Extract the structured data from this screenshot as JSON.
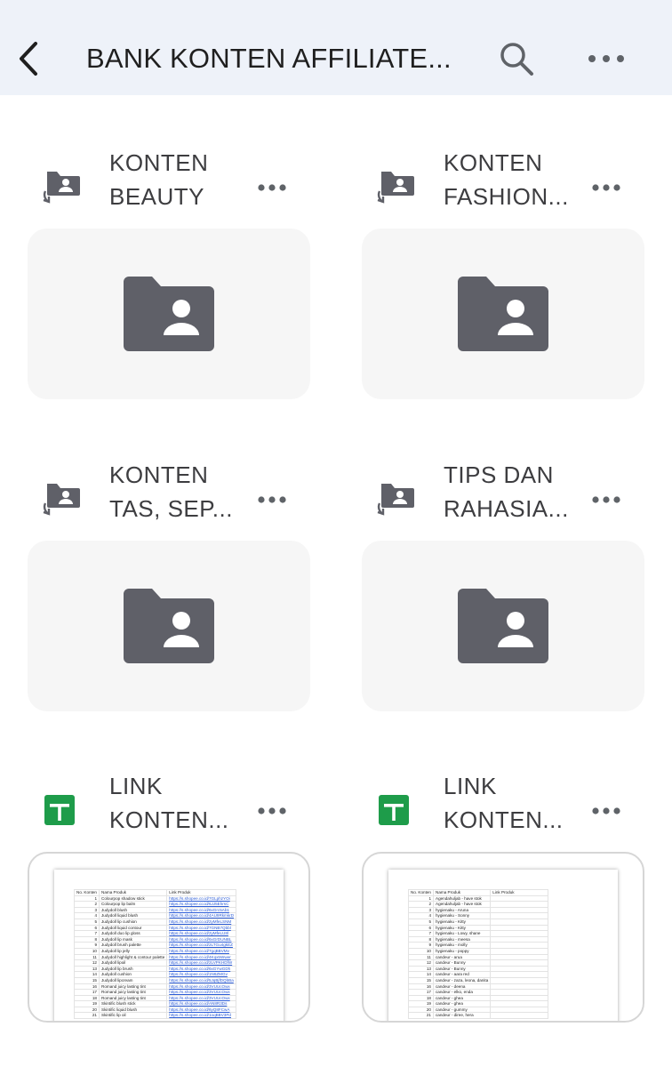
{
  "header": {
    "title": "BANK KONTEN AFFILIATE..."
  },
  "icons": {
    "back": "chevron-left-icon",
    "search": "search-icon",
    "more": "more-horizontal-icon",
    "shared_folder": "shared-folder-icon",
    "sheets": "google-sheets-icon"
  },
  "colors": {
    "header_bg": "#eef2f9",
    "folder_icon": "#5f6068",
    "sheets_green": "#1e9c4a",
    "link_blue": "#2a5bd7"
  },
  "items": [
    {
      "line1": "KONTEN",
      "line2": "BEAUTY",
      "type": "shared-folder"
    },
    {
      "line1": "KONTEN",
      "line2": "FASHION...",
      "type": "shared-folder"
    },
    {
      "line1": "KONTEN",
      "line2": "TAS, SEP...",
      "type": "shared-folder"
    },
    {
      "line1": "TIPS DAN",
      "line2": "RAHASIA...",
      "type": "shared-folder"
    },
    {
      "line1": "LINK",
      "line2": "KONTEN...",
      "type": "spreadsheet"
    },
    {
      "line1": "LINK",
      "line2": "KONTEN...",
      "type": "spreadsheet"
    }
  ],
  "sheet1": {
    "headers": [
      "No. Konten",
      "Nama Produk",
      "Link Produk"
    ],
    "rows": [
      [
        "1",
        "Colourpop shadow stick",
        "https://s.shopee.co.id/7GLphzYOi"
      ],
      [
        "2",
        "Colourpop lip balm",
        "https://s.shopee.co.id/6JJ5EhrsC"
      ],
      [
        "3",
        "Judydoll blush",
        "https://s.shopee.co.id/6xGrc5Ab1"
      ],
      [
        "4",
        "Judydoll liquid blush",
        "https://s.shopee.co.id/4AU9RkmkrD"
      ],
      [
        "5",
        "Judydoll lip cushion",
        "https://s.shopee.co.id/2yMfeLSNM"
      ],
      [
        "6",
        "Judydoll liquid contour",
        "https://s.shopee.co.id/7GNB7Qbbl"
      ],
      [
        "7",
        "Judydoll duo lip gloss",
        "https://s.shopee.co.id/2yMfeLU8l"
      ],
      [
        "8",
        "Judydoll lip mask",
        "https://s.shopee.co.id/6xGrDUNBL"
      ],
      [
        "9",
        "Judydoll brush palette",
        "https://s.shopee.co.id/2LTGu4gkEZ"
      ],
      [
        "10",
        "Judydoll lip jelly",
        "https://s.shopee.co.id/7gqBBVMv"
      ],
      [
        "11",
        "Judydoll highlight & contour palette",
        "https://s.shopee.co.id/4Kqx5Wwer"
      ],
      [
        "12",
        "Judydoll lipoil",
        "https://s.shopee.co.id/2LVPKHDfW"
      ],
      [
        "13",
        "Judydoll lip brush",
        "https://s.shopee.co.id/6xGYwGDh"
      ],
      [
        "14",
        "Judydoll cushion",
        "https://s.shopee.co.id/1N6ZMGv"
      ],
      [
        "15",
        "Judydoll lipcream",
        "https://s.shopee.co.id/5JqBjfDQbBa"
      ],
      [
        "16",
        "Romand juicy lasting tint",
        "https://s.shopee.co.id/3VUUcOwx"
      ],
      [
        "17",
        "Romand juicy lasting tint",
        "https://s.shopee.co.id/3VUUcOwx"
      ],
      [
        "18",
        "Romand juicy lasting tint",
        "https://s.shopee.co.id/3VUUcOwx"
      ],
      [
        "19",
        "Skintific blush stick",
        "https://s.shopee.co.id/AN8R3Ds"
      ],
      [
        "20",
        "Skintific liquid blush",
        "https://s.shopee.co.id/6yQ8FCwA"
      ],
      [
        "21",
        "Skintific lip oil",
        "https://s.shopee.co.id/1oqBBV3Pd"
      ]
    ]
  },
  "sheet2": {
    "headers": [
      "No. Konten",
      "Nama Produk",
      "Link Produk"
    ],
    "rows": [
      [
        "1",
        "Agendahuljab - have stok",
        ""
      ],
      [
        "2",
        "Agendahuljab - have stok",
        ""
      ],
      [
        "3",
        "hygienaku - Aruna",
        ""
      ],
      [
        "4",
        "hygienaku - Sonny",
        ""
      ],
      [
        "5",
        "hygienaku - Kitty",
        ""
      ],
      [
        "6",
        "hygienaku - Kitty",
        ""
      ],
      [
        "7",
        "hygienaku - Lowy, shane",
        ""
      ],
      [
        "8",
        "hygienaku - meesa",
        ""
      ],
      [
        "9",
        "hygienaku - molly",
        ""
      ],
      [
        "10",
        "hygienaku - poppy",
        ""
      ],
      [
        "11",
        "candeur - arua",
        ""
      ],
      [
        "12",
        "candeur - Bunny",
        ""
      ],
      [
        "13",
        "candeur - Bunny",
        ""
      ],
      [
        "14",
        "candeur - aara red",
        ""
      ],
      [
        "15",
        "candeur - zaza, leona, danita",
        ""
      ],
      [
        "16",
        "candeur - deena",
        ""
      ],
      [
        "17",
        "candeur - elko, enda",
        ""
      ],
      [
        "18",
        "candeur - ghea",
        ""
      ],
      [
        "19",
        "candeur - ghea",
        ""
      ],
      [
        "20",
        "candeur - gummy",
        ""
      ],
      [
        "21",
        "candeur - diree, hera",
        ""
      ]
    ]
  }
}
